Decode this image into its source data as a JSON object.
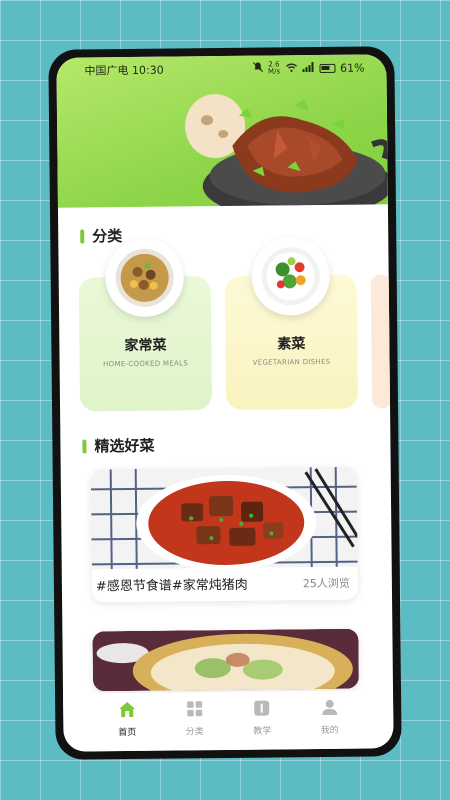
{
  "status_bar": {
    "carrier_time": "中国广电 10:30",
    "net_speed_value": "2.6",
    "net_speed_unit": "M/s",
    "battery": "61%"
  },
  "sections": {
    "category_title": "分类",
    "featured_title": "精选好菜"
  },
  "categories": [
    {
      "name": "家常菜",
      "subtitle": "HOME-COOKED MEALS"
    },
    {
      "name": "素菜",
      "subtitle": "VEGETARIAN DISHES"
    }
  ],
  "feed": [
    {
      "title": "#感恩节食谱#家常炖猪肉",
      "views": "25人浏览"
    }
  ],
  "tabbar": {
    "items": [
      {
        "label": "首页",
        "icon": "home-icon",
        "active": true
      },
      {
        "label": "分类",
        "icon": "grid-icon",
        "active": false
      },
      {
        "label": "教学",
        "icon": "book-icon",
        "active": false
      },
      {
        "label": "我的",
        "icon": "person-icon",
        "active": false
      }
    ]
  },
  "colors": {
    "accent": "#7cc93a",
    "background": "#5bbcc4"
  }
}
